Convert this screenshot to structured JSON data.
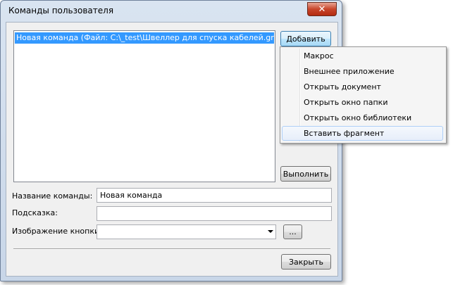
{
  "window": {
    "title": "Команды пользователя",
    "close_glyph": "✕"
  },
  "commands_list": {
    "items": [
      "Новая команда (Файл: C:\\_test\\Швеллер для спуска кабелей.grb)"
    ]
  },
  "buttons": {
    "add": "Добавить",
    "execute": "Выполнить",
    "browse": "...",
    "close": "Закрыть"
  },
  "form": {
    "command_name_label": "Название команды:",
    "command_name_value": "Новая команда",
    "hint_label": "Подсказка:",
    "hint_value": "",
    "button_image_label": "Изображение кнопки:",
    "button_image_value": ""
  },
  "add_menu": {
    "items": [
      "Макрос",
      "Внешнее приложение",
      "Открыть документ",
      "Открыть окно папки",
      "Открыть окно библиотеки",
      "Вставить фрагмент"
    ],
    "hovered_index": 5
  },
  "colors": {
    "selection": "#3399ff",
    "close_button": "#c8452b"
  }
}
